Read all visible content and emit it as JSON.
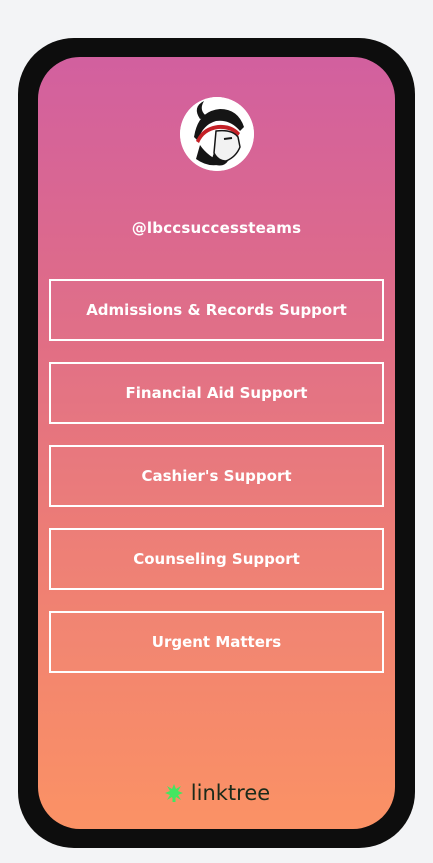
{
  "profile": {
    "handle": "@lbccsuccessteams",
    "avatar_icon": "viking-mascot-icon"
  },
  "links": [
    {
      "label": "Admissions & Records Support"
    },
    {
      "label": "Financial Aid Support"
    },
    {
      "label": "Cashier's Support"
    },
    {
      "label": "Counseling Support"
    },
    {
      "label": "Urgent Matters"
    }
  ],
  "footer": {
    "brand": "linktree",
    "logo_icon": "linktree-logo-icon"
  },
  "colors": {
    "gradient_top": "#d2609f",
    "gradient_bottom": "#fb9265",
    "button_border": "#ffffff",
    "frame": "#0d0d0d",
    "logo_green": "#43e660"
  }
}
